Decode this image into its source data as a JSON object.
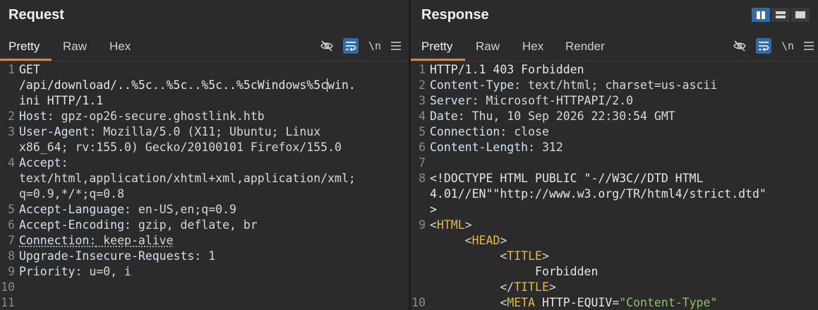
{
  "request": {
    "title": "Request",
    "tabs": [
      "Pretty",
      "Raw",
      "Hex"
    ],
    "active_tab": "Pretty",
    "toolbar": {
      "hide_icon": "eye-off-icon",
      "wrap_icon": "wrap-lines-icon",
      "newline_label": "\\n",
      "menu_icon": "hamburger-menu-icon"
    },
    "lines": [
      {
        "n": "1",
        "text": "GET"
      },
      {
        "n": "",
        "text_a": "/api/download/..%5c..%5c..%5c..%5cWindows%5c",
        "text_b": "win."
      },
      {
        "n": "",
        "text": "ini HTTP/1.1"
      },
      {
        "n": "2",
        "name": "Host",
        "value": " gpz-op26-secure.ghostlink.htb"
      },
      {
        "n": "3",
        "name": "User-Agent",
        "value": " Mozilla/5.0 (X11; Ubuntu; Linux"
      },
      {
        "n": "",
        "text": "x86_64; rv:155.0) Gecko/20100101 Firefox/155.0"
      },
      {
        "n": "4",
        "name": "Accept",
        "value": ""
      },
      {
        "n": "",
        "text": "text/html,application/xhtml+xml,application/xml;"
      },
      {
        "n": "",
        "text": "q=0.9,*/*;q=0.8"
      },
      {
        "n": "5",
        "name": "Accept-Language",
        "value": " en-US,en;q=0.9"
      },
      {
        "n": "6",
        "name": "Accept-Encoding",
        "value": " gzip, deflate, br"
      },
      {
        "n": "7",
        "name": "Connection",
        "value": " keep-alive"
      },
      {
        "n": "8",
        "name": "Upgrade-Insecure-Requests",
        "value": " 1"
      },
      {
        "n": "9",
        "name": "Priority",
        "value": " u=0, i"
      },
      {
        "n": "10",
        "text": ""
      },
      {
        "n": "11",
        "text": ""
      }
    ]
  },
  "response": {
    "title": "Response",
    "tabs": [
      "Pretty",
      "Raw",
      "Hex",
      "Render"
    ],
    "active_tab": "Pretty",
    "layout_icons": [
      "split-vertical-icon",
      "split-horizontal-icon",
      "single-pane-icon"
    ],
    "toolbar": {
      "hide_icon": "eye-off-icon",
      "wrap_icon": "wrap-lines-icon",
      "newline_label": "\\n",
      "menu_icon": "hamburger-menu-icon"
    },
    "lines": [
      {
        "n": "1",
        "text": "HTTP/1.1 403 Forbidden"
      },
      {
        "n": "2",
        "name": "Content-Type",
        "value": " text/html; charset=us-ascii"
      },
      {
        "n": "3",
        "name": "Server",
        "value": " Microsoft-HTTPAPI/2.0"
      },
      {
        "n": "4",
        "name": "Date",
        "value": " Thu, 10 Sep 2026 22:30:54 GMT"
      },
      {
        "n": "5",
        "name": "Connection",
        "value": " close"
      },
      {
        "n": "6",
        "name": "Content-Length",
        "value": " 312"
      },
      {
        "n": "7",
        "text": ""
      },
      {
        "n": "8",
        "text": "<!DOCTYPE HTML PUBLIC \"-//W3C//DTD HTML"
      },
      {
        "n": "",
        "text": "4.01//EN\"\"http://www.w3.org/TR/html4/strict.dtd\""
      },
      {
        "n": "",
        "text": ">"
      },
      {
        "n": "9",
        "indent": "",
        "open": "<",
        "tag": "HTML",
        "close": ">"
      },
      {
        "n": "",
        "indent": "     ",
        "open": "<",
        "tag": "HEAD",
        "close": ">"
      },
      {
        "n": "",
        "indent": "          ",
        "open": "<",
        "tag": "TITLE",
        "close": ">"
      },
      {
        "n": "",
        "text": "               Forbidden"
      },
      {
        "n": "",
        "indent": "          ",
        "open": "</",
        "tag": "TITLE",
        "close": ">"
      },
      {
        "n": "10",
        "indent": "          ",
        "open": "<",
        "tag": "META",
        "attr": " HTTP-EQUIV",
        "eq": "=",
        "aval": "\"Content-Type\""
      }
    ]
  },
  "colors": {
    "accent_tab": "#e8803a",
    "toggle_on": "#2f6ca8",
    "background": "#2b2b2b"
  }
}
